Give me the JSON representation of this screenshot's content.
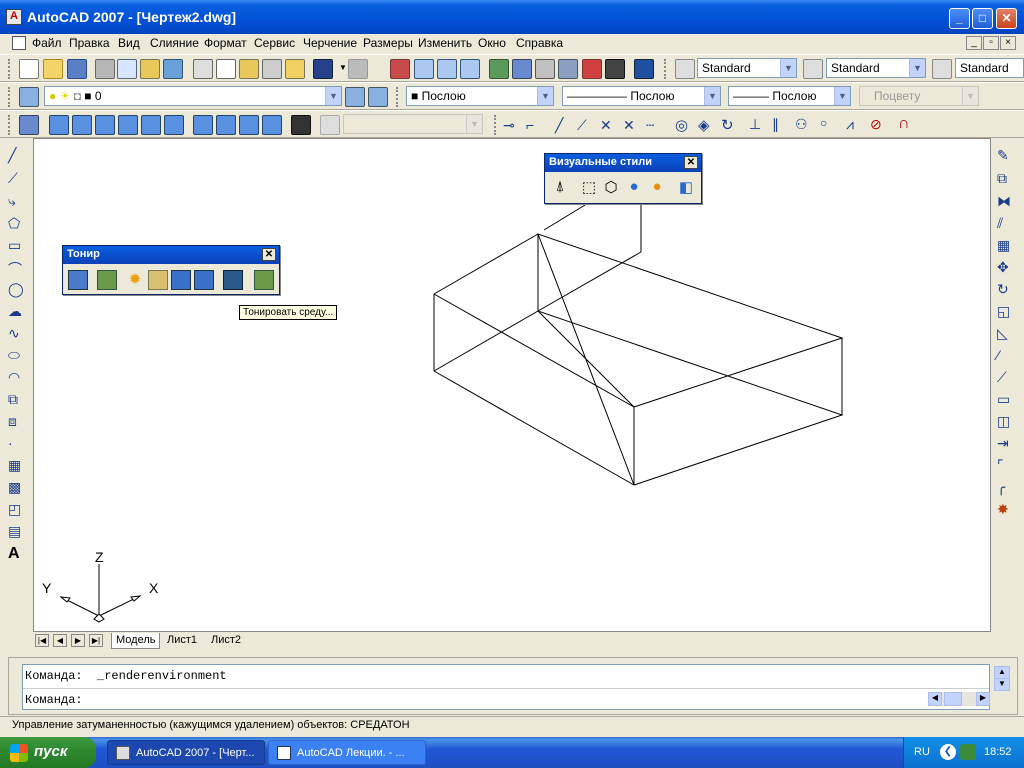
{
  "window": {
    "title": "AutoCAD 2007 - [Чертеж2.dwg]"
  },
  "menu": [
    "Файл",
    "Правка",
    "Вид",
    "Слияние",
    "Формат",
    "Сервис",
    "Черчение",
    "Размеры",
    "Изменить",
    "Окно",
    "Справка"
  ],
  "styles_toolbar": {
    "text_style": "Standard",
    "dim_style": "Standard",
    "table_style": "Standard"
  },
  "layers_toolbar": {
    "layer": "0"
  },
  "properties_toolbar": {
    "color": "Послою",
    "linetype": "Послою",
    "lineweight": "Послою",
    "plot_style": "Поцвету"
  },
  "floating": {
    "visual_styles": {
      "title": "Визуальные стили"
    },
    "render": {
      "title": "Тонир"
    },
    "tooltip": "Тонировать среду..."
  },
  "ucs": {
    "x": "X",
    "y": "Y",
    "z": "Z"
  },
  "tabs": [
    "Модель",
    "Лист1",
    "Лист2"
  ],
  "command": {
    "history": "Команда:  _renderenvironment",
    "prompt": "Команда:"
  },
  "status": {
    "text": "Управление затуманенностью (кажущимся удалением) объектов:  СРЕДАТОН"
  },
  "taskbar": {
    "start_label": "пуск",
    "tasks": [
      "AutoCAD 2007 - [Черт...",
      "AutoCAD Лекции. - ..."
    ],
    "lang": "RU",
    "clock": "18:52"
  }
}
